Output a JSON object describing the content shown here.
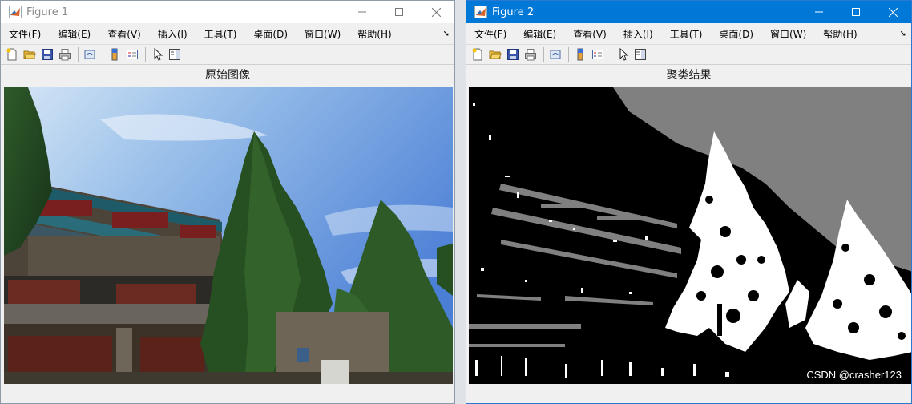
{
  "windows": [
    {
      "title": "Figure 1",
      "active": false,
      "menu": [
        "文件(F)",
        "编辑(E)",
        "查看(V)",
        "插入(I)",
        "工具(T)",
        "桌面(D)",
        "窗口(W)",
        "帮助(H)"
      ],
      "axes_title": "原始图像",
      "image_kind": "original-photo"
    },
    {
      "title": "Figure 2",
      "active": true,
      "menu": [
        "文件(F)",
        "编辑(E)",
        "查看(V)",
        "插入(I)",
        "工具(T)",
        "桌面(D)",
        "窗口(W)",
        "帮助(H)"
      ],
      "axes_title": "聚类结果",
      "image_kind": "clustered-result"
    }
  ],
  "toolbar_icons": [
    "new-file-icon",
    "open-folder-icon",
    "save-icon",
    "print-icon",
    "link-figure-icon",
    "colorbar-icon",
    "legend-icon",
    "edit-plot-arrow-icon",
    "property-inspector-icon"
  ],
  "watermark": "CSDN @crasher123",
  "colors": {
    "active_titlebar": "#0078d7",
    "inactive_titlebar": "#ffffff",
    "cluster_dark": "#000000",
    "cluster_mid": "#808080",
    "cluster_light": "#ffffff"
  }
}
